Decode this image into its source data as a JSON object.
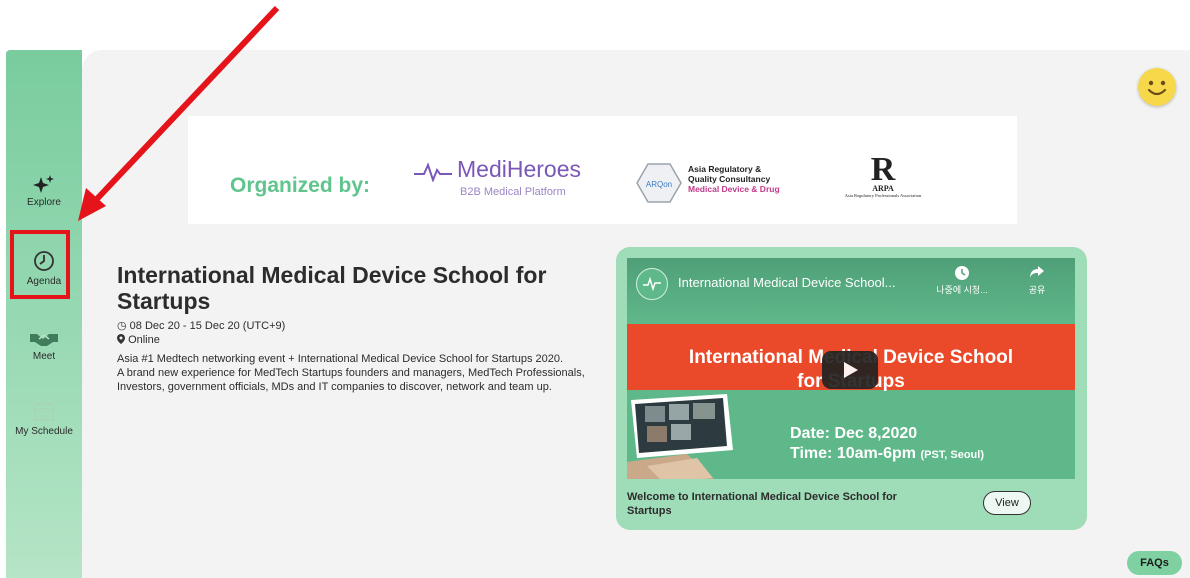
{
  "sidebar": {
    "items": [
      {
        "label": "Explore",
        "icon": "sparkles-icon"
      },
      {
        "label": "Agenda",
        "icon": "clock-icon"
      },
      {
        "label": "Meet",
        "icon": "handshake-icon"
      },
      {
        "label": "My Schedule",
        "icon": "calendar-icon"
      }
    ]
  },
  "banner": {
    "organized_by": "Organized by:",
    "mediheroes_name": "MediHeroes",
    "mediheroes_sub": "B2B Medical Platform",
    "arqon_logo": "ARQon",
    "arq_line1": "Asia Regulatory &",
    "arq_line2": "Quality Consultancy",
    "arq_line3": "Medical Device & Drug",
    "arpa_letter": "R",
    "arpa_name": "ARPA",
    "arpa_full": "Asia Regulatory Professionals Association"
  },
  "event": {
    "title": "International Medical Device School for Startups",
    "dates": "08 Dec 20 - 15 Dec 20 (UTC+9)",
    "location": "Online",
    "desc_line1": "Asia #1 Medtech networking event + International Medical Device School for Startups 2020.",
    "desc_line2": "A brand new experience for MedTech Startups founders and managers, MedTech Professionals, Investors, government officials, MDs and IT companies to discover, network and team up."
  },
  "video": {
    "title": "International Medical Device School...",
    "watch_later": "나중에 시청...",
    "share": "공유",
    "headline_line1": "International Medical Device School",
    "headline_line2": "for Startups",
    "date_line": "Date: Dec 8,2020",
    "time_line": "Time: 10am-6pm",
    "time_zone": "(PST, Seoul)"
  },
  "card": {
    "caption": "Welcome to International Medical Device School for Startups",
    "view_label": "View"
  },
  "faq_label": "FAQs",
  "colors": {
    "sidebar": "#79cc9e",
    "annotation_red": "#e5141b",
    "video_red": "#ea4a2a",
    "video_green": "#5fb88a",
    "mediheroes_purple": "#7a58b8"
  }
}
